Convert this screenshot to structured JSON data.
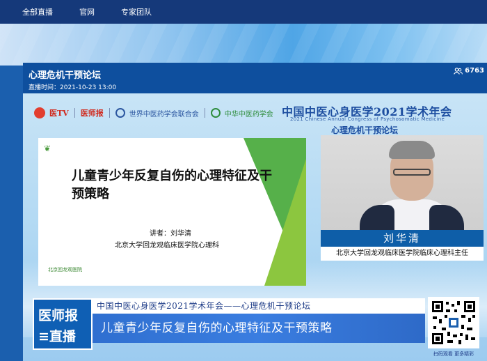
{
  "nav": {
    "items": [
      "全部直播",
      "官网",
      "专家团队"
    ]
  },
  "room": {
    "title": "心理危机干预论坛",
    "live_time": "直播时间：2021-10-23 13:00",
    "viewer_count": "6763",
    "viewer_icon": "people-icon"
  },
  "logos": {
    "tv": "医TV",
    "paper": "医师报",
    "wfcms": "世界中医药学会联合会",
    "cacm": "中华中医药学会"
  },
  "conference": {
    "title": "中国中医心身医学2021学术年会",
    "title_en": "2021 Chinese Annual Congress of Psychosomatic Medicine",
    "subtitle": "心理危机干预论坛"
  },
  "slide": {
    "title": "儿童青少年反复自伤的心理特征及干预策略",
    "speaker": "讲者：刘华清",
    "affiliation": "北京大学回龙观临床医学院心理科",
    "footer": "北京回龙观医院"
  },
  "speaker": {
    "name": "刘华清",
    "title": "北京大学回龙观临床医学院临床心理科主任"
  },
  "lower_third": {
    "badge_line1": "医师报",
    "badge_line2": "≡直播",
    "event": "中国中医心身医学2021学术年会——心理危机干预论坛",
    "topic": "儿童青少年反复自伤的心理特征及干预策略"
  },
  "qr": {
    "caption": "扫码观看 更多精彩"
  },
  "colors": {
    "nav_bg": "#15397a",
    "header_bg": "#0e4f9e",
    "banner_blue": "#3a7de0",
    "slide_green": "#56b04a"
  }
}
